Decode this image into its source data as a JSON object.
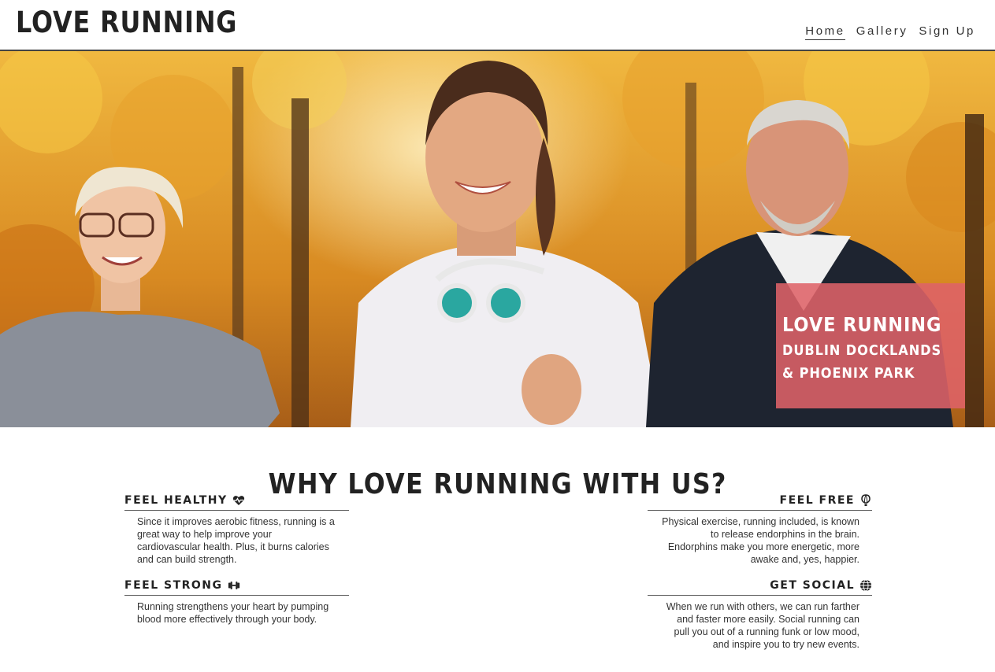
{
  "header": {
    "logo": "LOVE RUNNING",
    "nav": [
      "Home",
      "Gallery",
      "Sign Up"
    ]
  },
  "hero": {
    "title": "LOVE RUNNING",
    "subtitle": "DUBLIN DOCKLANDS & PHOENIX PARK"
  },
  "section": {
    "heading": "WHY LOVE RUNNING WITH US?"
  },
  "features": {
    "healthy": {
      "title": "FEEL HEALTHY",
      "icon": "heartbeat-icon",
      "text": "Since it improves aerobic fitness, running is a great way to help improve your cardiovascular health. Plus, it burns calories and can build strength."
    },
    "strong": {
      "title": "FEEL STRONG",
      "icon": "dumbbell-icon",
      "text": "Running strengthens your heart by pumping blood more effectively through your body."
    },
    "free": {
      "title": "FEEL FREE",
      "icon": "hot-air-balloon-icon",
      "text": "Physical exercise, running included, is known to release endorphins in the brain. Endorphins make you more energetic, more awake and, yes, happier."
    },
    "social": {
      "title": "GET SOCIAL",
      "icon": "globe-icon",
      "text": "When we run with others, we can run farther and faster more easily. Social running can pull you out of a running funk or low mood, and inspire you to try new events."
    }
  },
  "colors": {
    "hero_box": "#de6268",
    "text": "#222222",
    "autumn": "#e0a02a"
  }
}
